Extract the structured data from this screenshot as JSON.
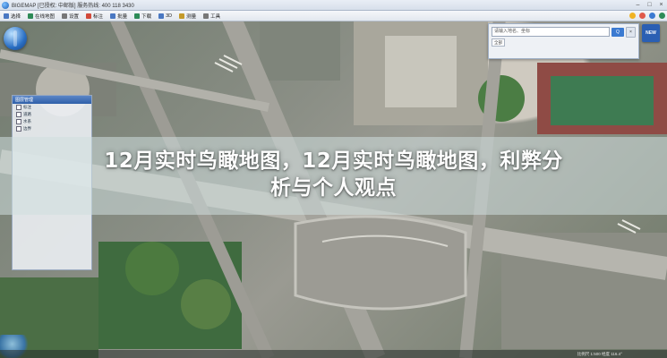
{
  "window": {
    "title": "BIGEMAP [已授权: 中邮版]  服务热线: 400 118 3430"
  },
  "toolbar": {
    "items": [
      {
        "label": "选择",
        "icon": "select-icon",
        "color": "#4a78c2"
      },
      {
        "label": "在线地图",
        "icon": "map-icon",
        "color": "#2e8b57"
      },
      {
        "label": "设置",
        "icon": "gear-icon",
        "color": "#777777"
      },
      {
        "label": "标注",
        "icon": "marker-icon",
        "color": "#d24a3a"
      },
      {
        "label": "批量",
        "icon": "batch-icon",
        "color": "#4a78c2"
      },
      {
        "label": "下载",
        "icon": "download-icon",
        "color": "#2e8b57"
      },
      {
        "label": "3D",
        "icon": "3d-icon",
        "color": "#4a78c2"
      },
      {
        "label": "测量",
        "icon": "ruler-icon",
        "color": "#c49a2a"
      },
      {
        "label": "工具",
        "icon": "tool-icon",
        "color": "#777777"
      }
    ]
  },
  "search": {
    "placeholder": "请输入地名、坐标",
    "button_label": "Q",
    "close_label": "×",
    "scope_label": "全部"
  },
  "logo": {
    "text": "NEW"
  },
  "layer_panel": {
    "title": "图层管理",
    "rows": [
      "标注",
      "道路",
      "水系",
      "边界"
    ]
  },
  "status": {
    "text": "比例尺 1:500  经度 116.4°"
  },
  "headline": {
    "line1": "12月实时鸟瞰地图，12月实时鸟瞰地图，利弊分",
    "line2": "析与个人观点"
  }
}
